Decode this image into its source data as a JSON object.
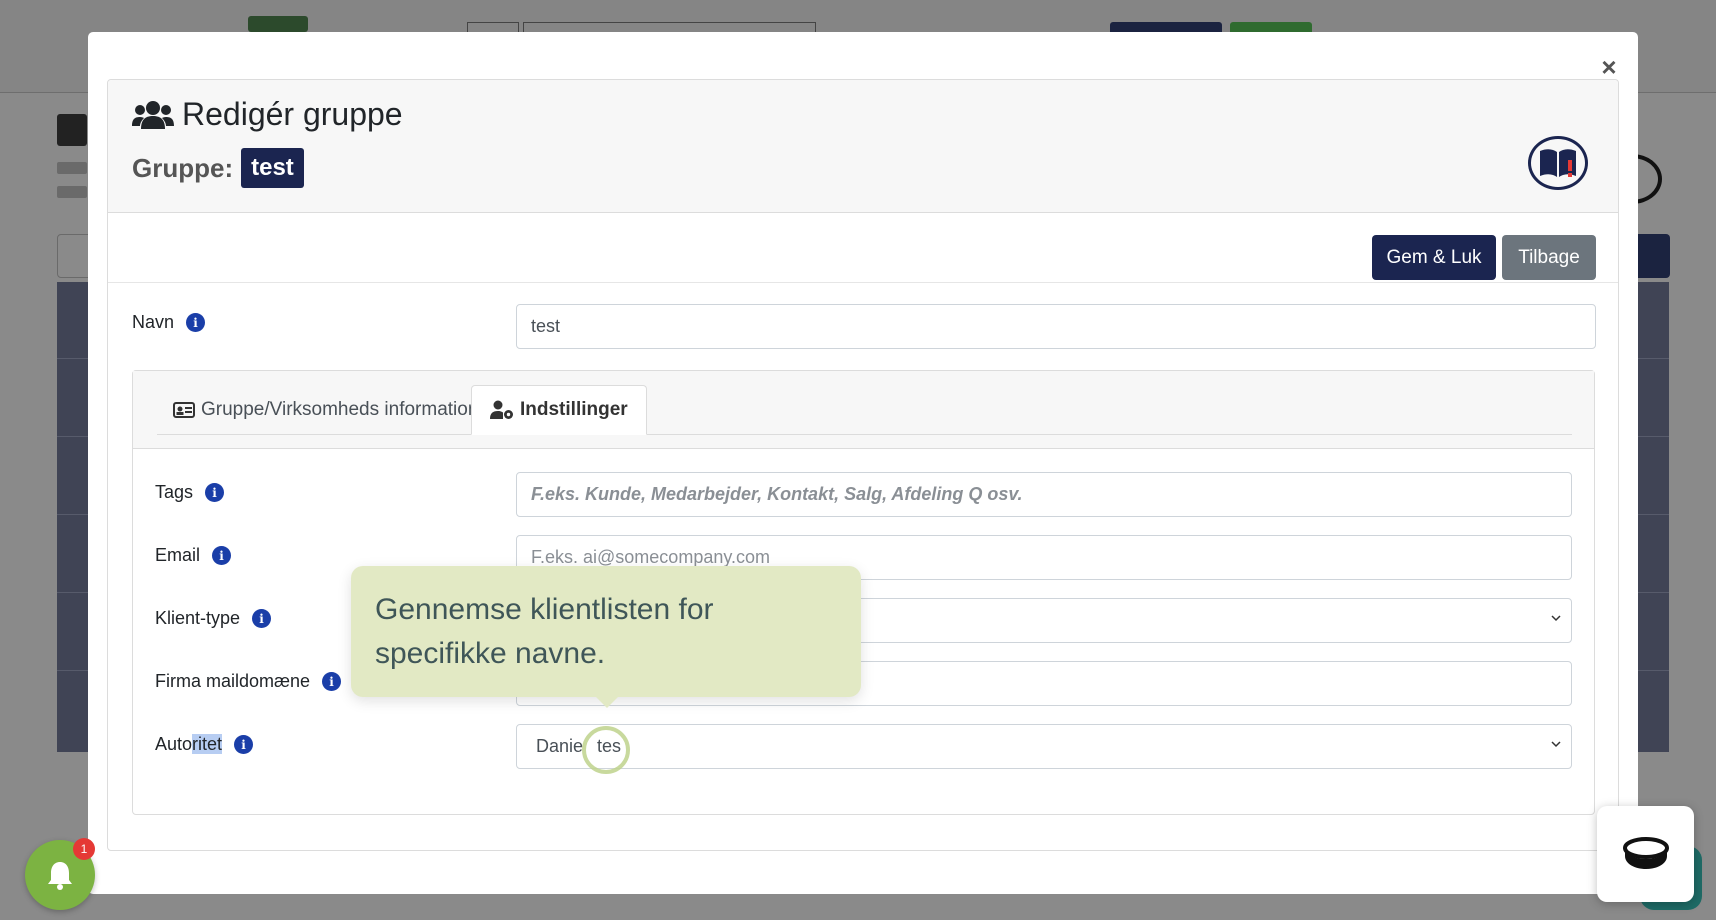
{
  "modal": {
    "close_label": "×",
    "title": "Redigér gruppe",
    "subtitle_label": "Gruppe:",
    "group_badge": "test",
    "save_button": "Gem & Luk",
    "back_button": "Tilbage"
  },
  "name_field": {
    "label": "Navn",
    "value": "test"
  },
  "tabs": [
    {
      "label": "Gruppe/Virksomheds information",
      "icon": "id-card-icon",
      "active": false
    },
    {
      "label": "Indstillinger",
      "icon": "user-gear-icon",
      "active": true
    }
  ],
  "settings": {
    "tags": {
      "label": "Tags",
      "placeholder": "F.eks. Kunde, Medarbejder, Kontakt, Salg, Afdeling Q osv."
    },
    "email": {
      "label": "Email",
      "placeholder": "F.eks. ai@somecompany.com"
    },
    "client_type": {
      "label": "Klient-type",
      "value": ""
    },
    "mail_domain": {
      "label": "Firma maildomæne",
      "value": ""
    },
    "authority": {
      "label_prefix": "Auto",
      "label_highlight": "ritet",
      "value_a": "Danie",
      "value_b": "tes"
    }
  },
  "tooltip": {
    "text": "Gennemse klientlisten for specifikke navne."
  },
  "notifications": {
    "count": "1"
  },
  "colors": {
    "primary": "#1b2550",
    "secondary": "#6c757d",
    "info": "#1a3ea8",
    "tooltip_bg": "#e2e9c4",
    "bell": "#7cb342"
  }
}
